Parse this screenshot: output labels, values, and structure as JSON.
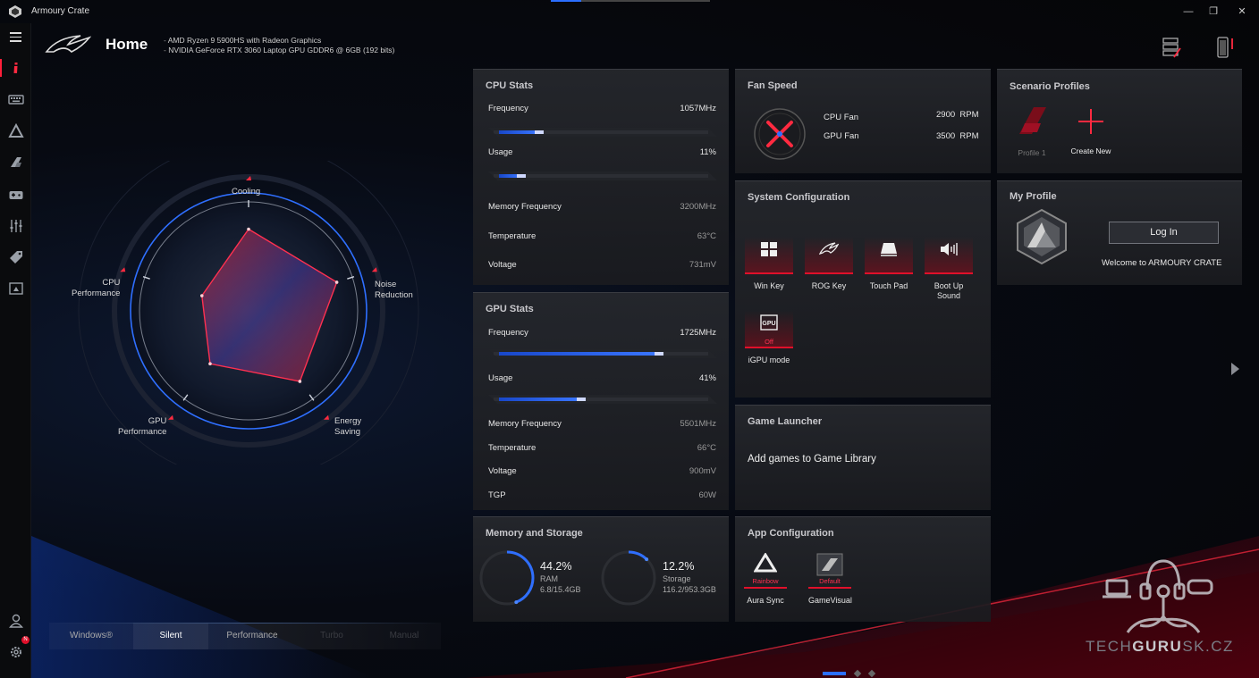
{
  "titlebar": {
    "title": "Armoury Crate",
    "minimize": "—",
    "maximize": "❐",
    "close": "✕"
  },
  "header": {
    "title": "Home",
    "specs": [
      "AMD Ryzen 9 5900HS with Radeon Graphics",
      "NVIDIA GeForce RTX 3060 Laptop GPU GDDR6 @ 6GB (192 bits)"
    ]
  },
  "sidebar": {
    "items": [
      {
        "icon": "info-icon"
      },
      {
        "icon": "keyboard-icon"
      },
      {
        "icon": "aura-icon"
      },
      {
        "icon": "armor-icon"
      },
      {
        "icon": "gamepad-icon"
      },
      {
        "icon": "sliders-icon"
      },
      {
        "icon": "tag-icon"
      },
      {
        "icon": "media-icon"
      }
    ],
    "notification_badge": "N"
  },
  "radar": {
    "labels": {
      "cooling": "Cooling",
      "noise": [
        "Noise",
        "Reduction"
      ],
      "energy": [
        "Energy",
        "Saving"
      ],
      "gpu": [
        "GPU",
        "Performance"
      ],
      "cpu": [
        "CPU",
        "Performance"
      ]
    },
    "values": {
      "cooling": 0.75,
      "noise": 0.85,
      "energy": 0.8,
      "gpu": 0.6,
      "cpu": 0.45
    }
  },
  "modes": {
    "items": [
      "Windows®",
      "Silent",
      "Performance",
      "Turbo",
      "Manual"
    ],
    "selected": "Silent"
  },
  "cpu_stats": {
    "title": "CPU Stats",
    "frequency": {
      "label": "Frequency",
      "value": "1057MHz",
      "fill": 0.2
    },
    "usage": {
      "label": "Usage",
      "value": "11%",
      "fill": 0.11
    },
    "memory_frequency": {
      "label": "Memory Frequency",
      "value": "3200MHz"
    },
    "temperature": {
      "label": "Temperature",
      "value": "63°C"
    },
    "voltage": {
      "label": "Voltage",
      "value": "731mV"
    }
  },
  "gpu_stats": {
    "title": "GPU Stats",
    "frequency": {
      "label": "Frequency",
      "value": "1725MHz",
      "fill": 0.8
    },
    "usage": {
      "label": "Usage",
      "value": "41%",
      "fill": 0.41
    },
    "memory_frequency": {
      "label": "Memory Frequency",
      "value": "5501MHz"
    },
    "temperature": {
      "label": "Temperature",
      "value": "66°C"
    },
    "voltage": {
      "label": "Voltage",
      "value": "900mV"
    },
    "tgp": {
      "label": "TGP",
      "value": "60W"
    }
  },
  "memory_storage": {
    "title": "Memory and Storage",
    "ram": {
      "pct": "44.2%",
      "label": "RAM",
      "detail": "6.8/15.4GB",
      "fill": 0.442
    },
    "storage": {
      "pct": "12.2%",
      "label": "Storage",
      "detail": "116.2/953.3GB",
      "fill": 0.122
    }
  },
  "fan_speed": {
    "title": "Fan Speed",
    "cpu": {
      "label": "CPU Fan",
      "value": "2900",
      "unit": "RPM"
    },
    "gpu": {
      "label": "GPU Fan",
      "value": "3500",
      "unit": "RPM"
    }
  },
  "system_config": {
    "title": "System Configuration",
    "tiles": [
      {
        "label": "Win Key",
        "icon": "windows-icon"
      },
      {
        "label": "ROG Key",
        "icon": "rog-eye-icon"
      },
      {
        "label": "Touch Pad",
        "icon": "touchpad-icon"
      },
      {
        "label": "Boot Up Sound",
        "icon": "sound-icon"
      }
    ],
    "igpu": {
      "label": "iGPU mode",
      "state": "Off",
      "icon": "gpu-chip-icon"
    }
  },
  "game_launcher": {
    "title": "Game Launcher",
    "text": "Add games to Game Library"
  },
  "app_config": {
    "title": "App Configuration",
    "tiles": [
      {
        "label": "Aura Sync",
        "state": "Rainbow",
        "icon": "aura-sync-icon"
      },
      {
        "label": "GameVisual",
        "state": "Default",
        "icon": "gamevisual-icon"
      }
    ]
  },
  "scenario_profiles": {
    "title": "Scenario Profiles",
    "profile": "Profile 1",
    "create": "Create New"
  },
  "my_profile": {
    "title": "My Profile",
    "login": "Log In",
    "welcome": "Welcome to ARMOURY CRATE"
  },
  "watermark": {
    "pre": "TECH",
    "bold": "GURU",
    "post": "SK.CZ"
  },
  "colors": {
    "accent_red": "#e0102a",
    "accent_blue": "#2b6fff",
    "card_bg": "#26282d"
  }
}
